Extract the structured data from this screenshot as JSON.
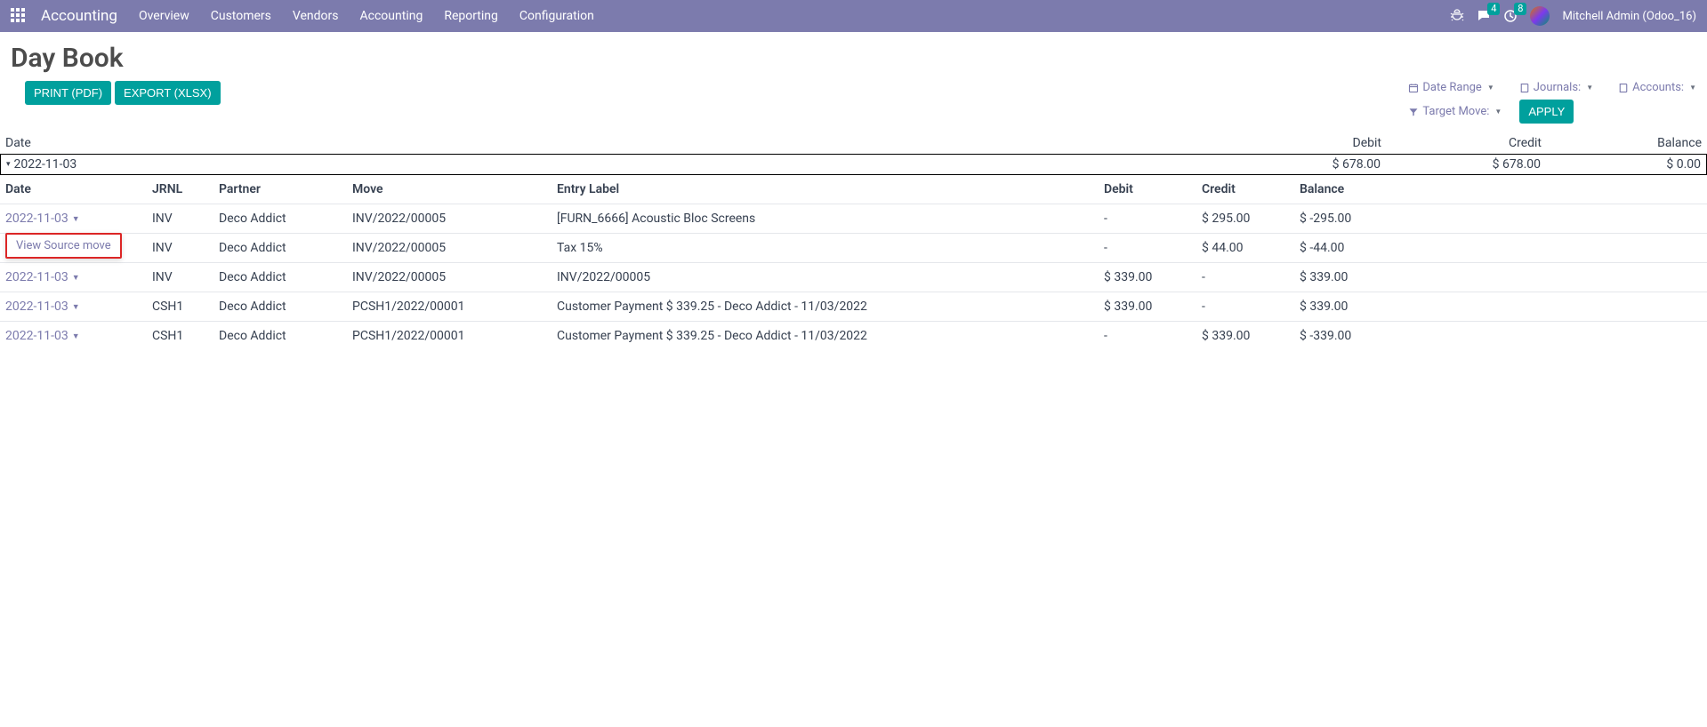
{
  "nav": {
    "app_name": "Accounting",
    "menu": [
      "Overview",
      "Customers",
      "Vendors",
      "Accounting",
      "Reporting",
      "Configuration"
    ],
    "msg_badge": "4",
    "activity_badge": "8",
    "user_name": "Mitchell Admin (Odoo_16)"
  },
  "page": {
    "title": "Day Book",
    "buttons": {
      "print": "PRINT (PDF)",
      "export": "EXPORT (XLSX)"
    },
    "filters": {
      "date_range": "Date Range",
      "journals": "Journals:",
      "accounts": "Accounts:",
      "target_move": "Target Move:",
      "apply": "APPLY"
    }
  },
  "summary": {
    "headers": {
      "date": "Date",
      "debit": "Debit",
      "credit": "Credit",
      "balance": "Balance"
    },
    "row": {
      "date": "2022-11-03",
      "debit": "$ 678.00",
      "credit": "$ 678.00",
      "balance": "$ 0.00"
    }
  },
  "detail": {
    "headers": {
      "date": "Date",
      "jrnl": "JRNL",
      "partner": "Partner",
      "move": "Move",
      "entry": "Entry Label",
      "debit": "Debit",
      "credit": "Credit",
      "balance": "Balance"
    },
    "popup_item": "View Source move",
    "rows": [
      {
        "date": "2022-11-03",
        "jrnl": "INV",
        "partner": "Deco Addict",
        "move": "INV/2022/00005",
        "entry": "[FURN_6666] Acoustic Bloc Screens",
        "debit": "-",
        "credit": "$ 295.00",
        "balance": "$ -295.00",
        "show_popup": true
      },
      {
        "date": "",
        "jrnl": "INV",
        "partner": "Deco Addict",
        "move": "INV/2022/00005",
        "entry": "Tax 15%",
        "debit": "-",
        "credit": "$ 44.00",
        "balance": "$ -44.00"
      },
      {
        "date": "2022-11-03",
        "jrnl": "INV",
        "partner": "Deco Addict",
        "move": "INV/2022/00005",
        "entry": "INV/2022/00005",
        "debit": "$ 339.00",
        "credit": "-",
        "balance": "$ 339.00"
      },
      {
        "date": "2022-11-03",
        "jrnl": "CSH1",
        "partner": "Deco Addict",
        "move": "PCSH1/2022/00001",
        "entry": "Customer Payment $ 339.25 - Deco Addict - 11/03/2022",
        "debit": "$ 339.00",
        "credit": "-",
        "balance": "$ 339.00"
      },
      {
        "date": "2022-11-03",
        "jrnl": "CSH1",
        "partner": "Deco Addict",
        "move": "PCSH1/2022/00001",
        "entry": "Customer Payment $ 339.25 - Deco Addict - 11/03/2022",
        "debit": "-",
        "credit": "$ 339.00",
        "balance": "$ -339.00"
      }
    ]
  }
}
